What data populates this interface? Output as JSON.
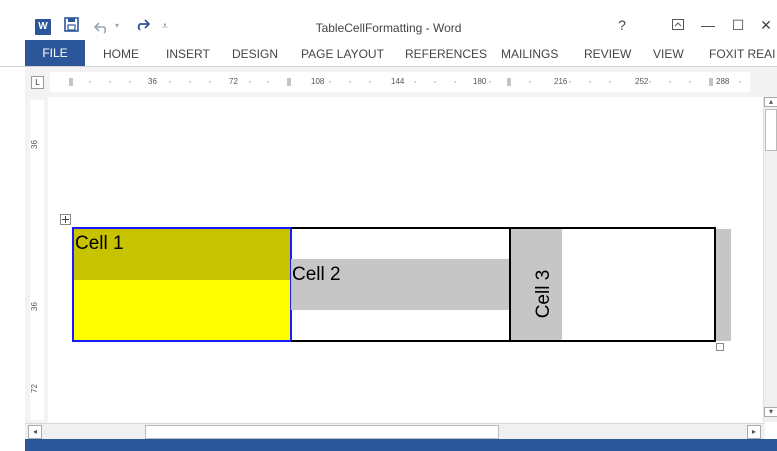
{
  "window": {
    "title": "TableCellFormatting - Word",
    "help": "?",
    "ribbon_display": "⊼",
    "minimize": "—",
    "maximize": "☐",
    "close": "✕"
  },
  "qat": {
    "save_icon": "save-icon",
    "undo_icon": "undo-icon",
    "redo_icon": "redo-icon",
    "customize_icon": "customize-icon"
  },
  "ribbon": {
    "tabs": [
      "FILE",
      "HOME",
      "INSERT",
      "DESIGN",
      "PAGE LAYOUT",
      "REFERENCES",
      "MAILINGS",
      "REVIEW",
      "VIEW",
      "FOXIT REAI"
    ]
  },
  "ruler": {
    "h_ticks": [
      "36",
      "72",
      "108",
      "144",
      "180",
      "216",
      "252",
      "288"
    ],
    "v_ticks": [
      "36",
      "36",
      "72"
    ]
  },
  "table": {
    "cells": [
      {
        "text": "Cell 1",
        "fill_top": "#c8c300",
        "fill_bottom": "#ffff00",
        "border": "#0000cc"
      },
      {
        "text": "Cell 2",
        "highlight": "#c6c6c6"
      },
      {
        "text": "Cell 3",
        "highlight": "#c6c6c6",
        "orientation": "vertical"
      }
    ]
  },
  "colors": {
    "accent": "#2b579a"
  }
}
